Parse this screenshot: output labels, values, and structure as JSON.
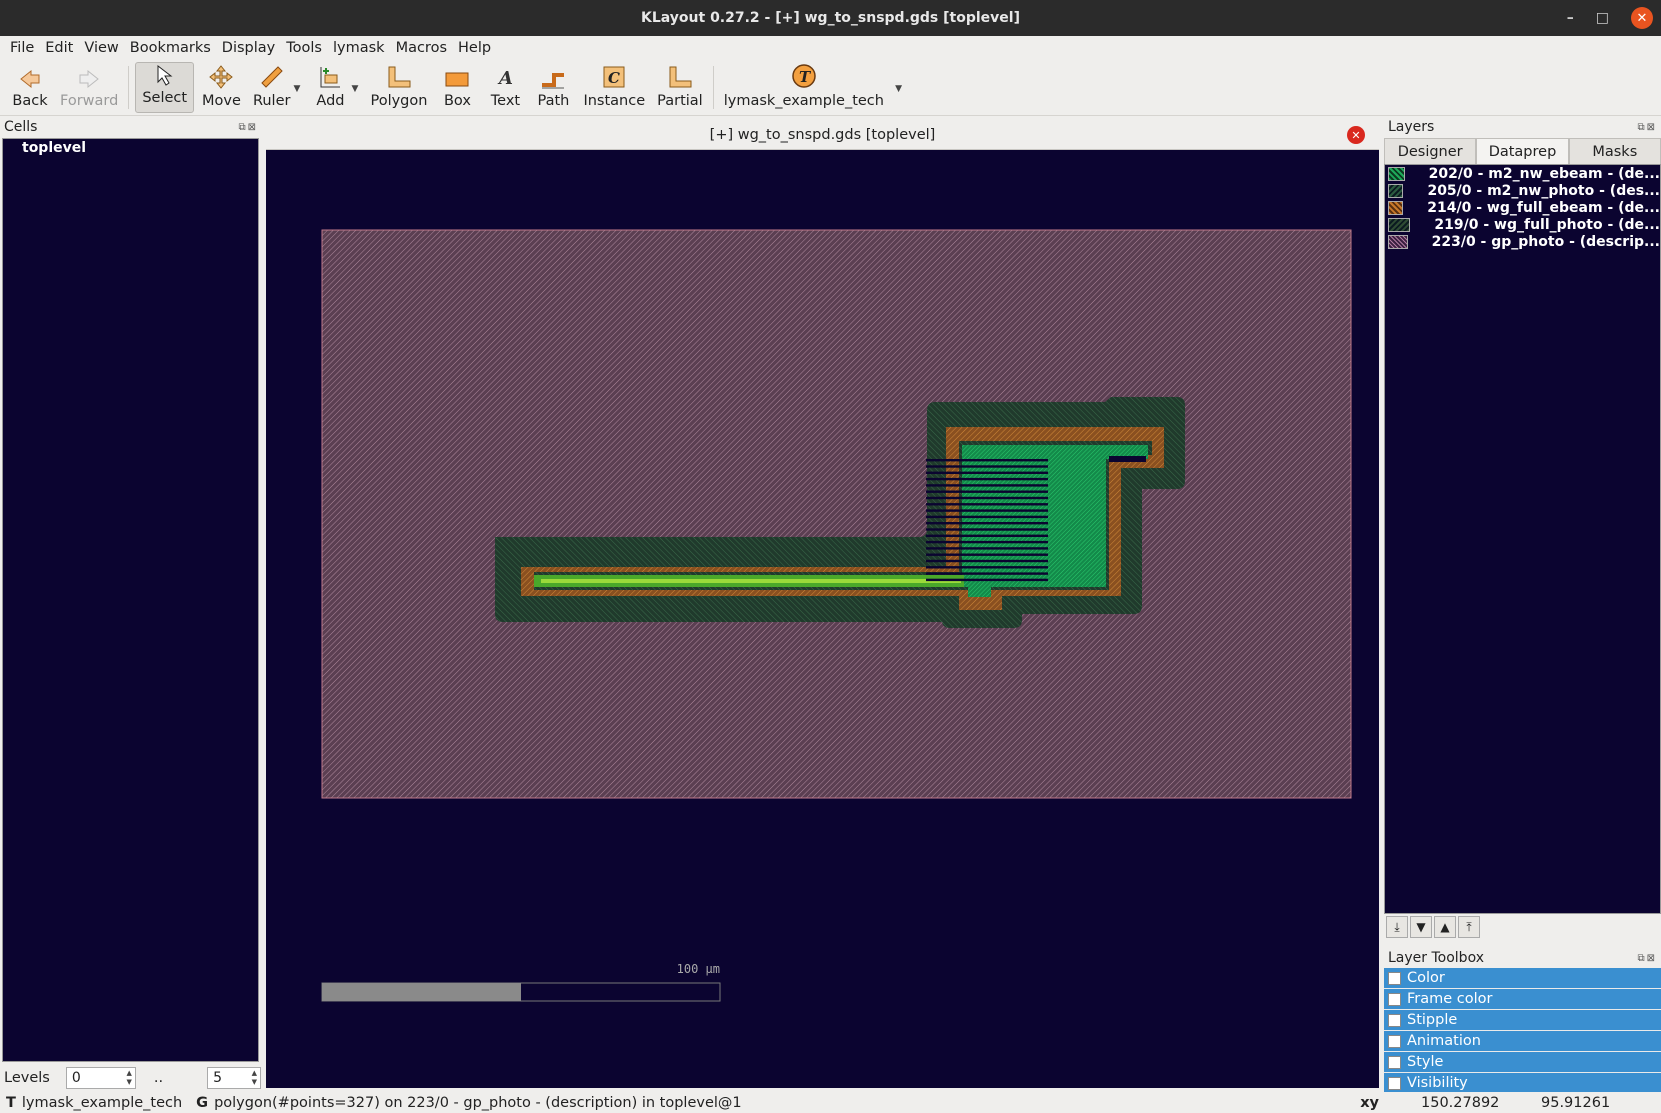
{
  "window": {
    "title": "KLayout 0.27.2 - [+] wg_to_snspd.gds [toplevel]"
  },
  "menu": [
    "File",
    "Edit",
    "View",
    "Bookmarks",
    "Display",
    "Tools",
    "lymask",
    "Macros",
    "Help"
  ],
  "toolbar": {
    "back": "Back",
    "forward": "Forward",
    "select": "Select",
    "move": "Move",
    "ruler": "Ruler",
    "add": "Add",
    "polygon": "Polygon",
    "box": "Box",
    "text": "Text",
    "path": "Path",
    "instance": "Instance",
    "partial": "Partial",
    "tech": "lymask_example_tech"
  },
  "cells": {
    "title": "Cells",
    "items": [
      "toplevel"
    ]
  },
  "levels": {
    "label": "Levels",
    "from": "0",
    "sep": "..",
    "to": "5"
  },
  "view": {
    "tab_title": "[+] wg_to_snspd.gds [toplevel]",
    "scale_label": "100 µm"
  },
  "layers": {
    "title": "Layers",
    "tabs": [
      "Designer",
      "Dataprep",
      "Masks"
    ],
    "selected_tab": "Dataprep",
    "items": [
      {
        "label": "202/0 - m2_nw_ebeam - (de...",
        "color": "#1ea95a"
      },
      {
        "label": "205/0 - m2_nw_photo - (des...",
        "color": "#2b5b40"
      },
      {
        "label": "214/0 - wg_full_ebeam - (de...",
        "color": "#c8782a"
      },
      {
        "label": "219/0 - wg_full_photo - (de...",
        "color": "#2e4b33"
      },
      {
        "label": "223/0 - gp_photo - (descrip...",
        "color": "#b07aa0"
      }
    ]
  },
  "toolbox": {
    "title": "Layer Toolbox",
    "items": [
      "Color",
      "Frame color",
      "Stipple",
      "Animation",
      "Style",
      "Visibility"
    ]
  },
  "status": {
    "tech_key": "T",
    "tech": "lymask_example_tech",
    "g_key": "G",
    "message": "polygon(#points=327) on 223/0 - gp_photo - (description) in toplevel@1",
    "xy_label": "xy",
    "x": "150.27892",
    "y": "95.91261"
  }
}
